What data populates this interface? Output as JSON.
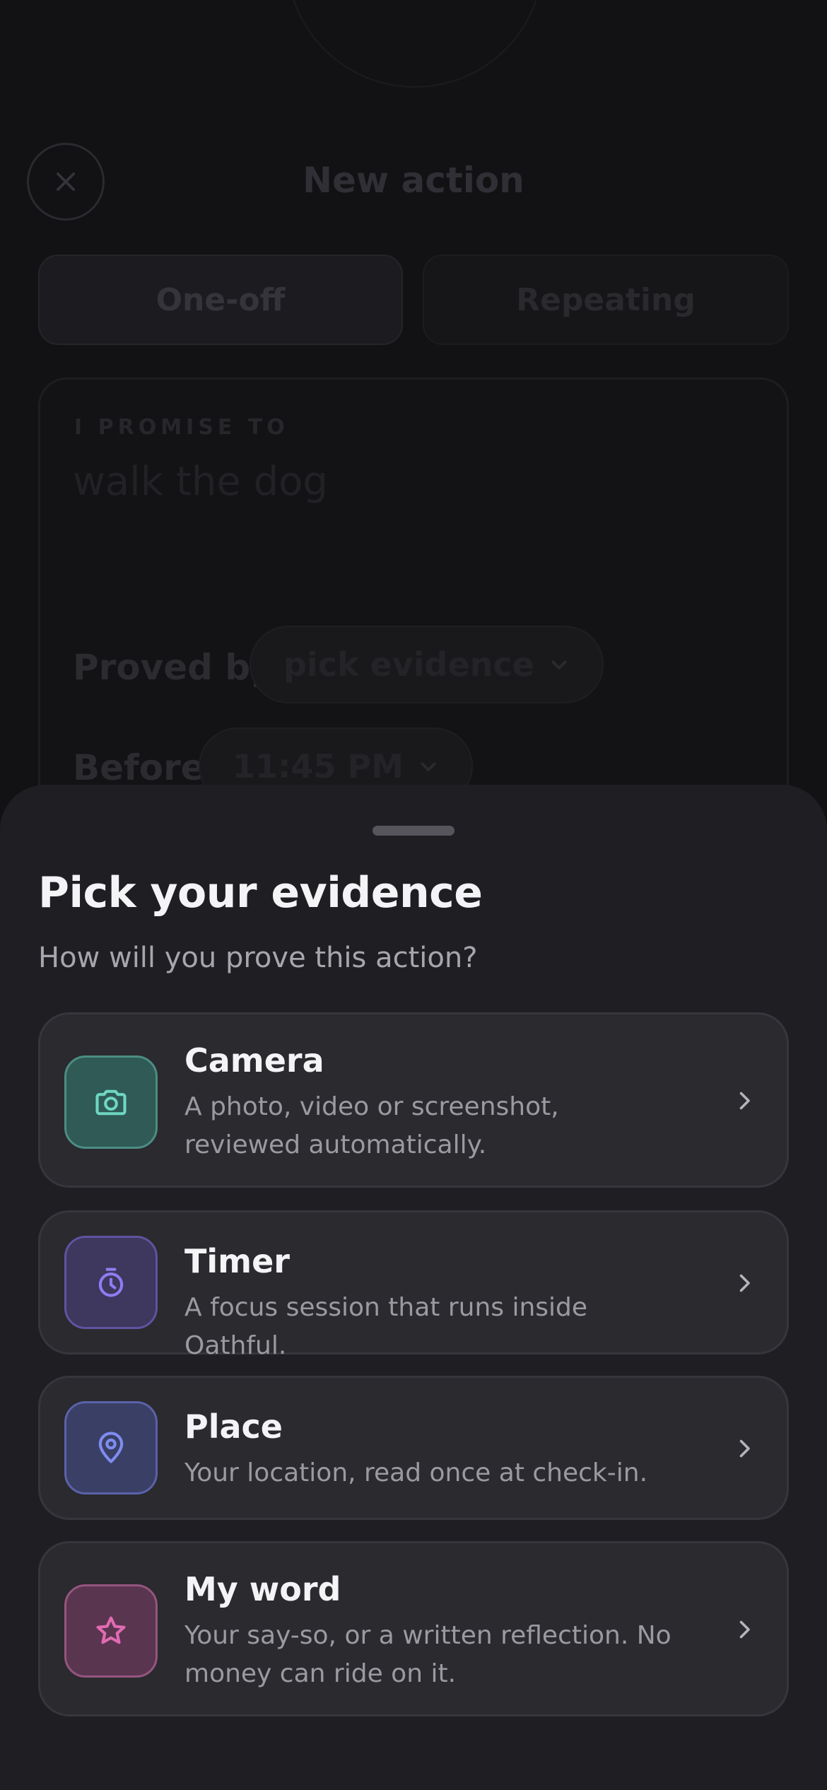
{
  "background": {
    "title": "New action",
    "tabs": [
      {
        "label": "One-off",
        "selected": true
      },
      {
        "label": "Repeating",
        "selected": false
      }
    ],
    "promise": {
      "label": "I PROMISE TO",
      "text": "walk the dog"
    },
    "proved_by": {
      "label": "Proved by",
      "value": "pick evidence"
    },
    "before": {
      "label": "Before",
      "value": "11:45 PM"
    }
  },
  "sheet": {
    "title": "Pick your evidence",
    "subtitle": "How will you prove this action?",
    "options": [
      {
        "title": "Camera",
        "description": "A photo, video or screenshot, reviewed automatically.",
        "icon": "camera-icon",
        "color": "#6fd6c2"
      },
      {
        "title": "Timer",
        "description": "A focus session that runs inside Oathful.",
        "icon": "stopwatch-icon",
        "color": "#8e7cf0"
      },
      {
        "title": "Place",
        "description": "Your location, read once at check-in.",
        "icon": "map-pin-icon",
        "color": "#7f8cf0"
      },
      {
        "title": "My word",
        "description": "Your say-so, or a written reflection. No money can ride on it.",
        "icon": "star-icon",
        "color": "#e16bb2"
      }
    ]
  }
}
